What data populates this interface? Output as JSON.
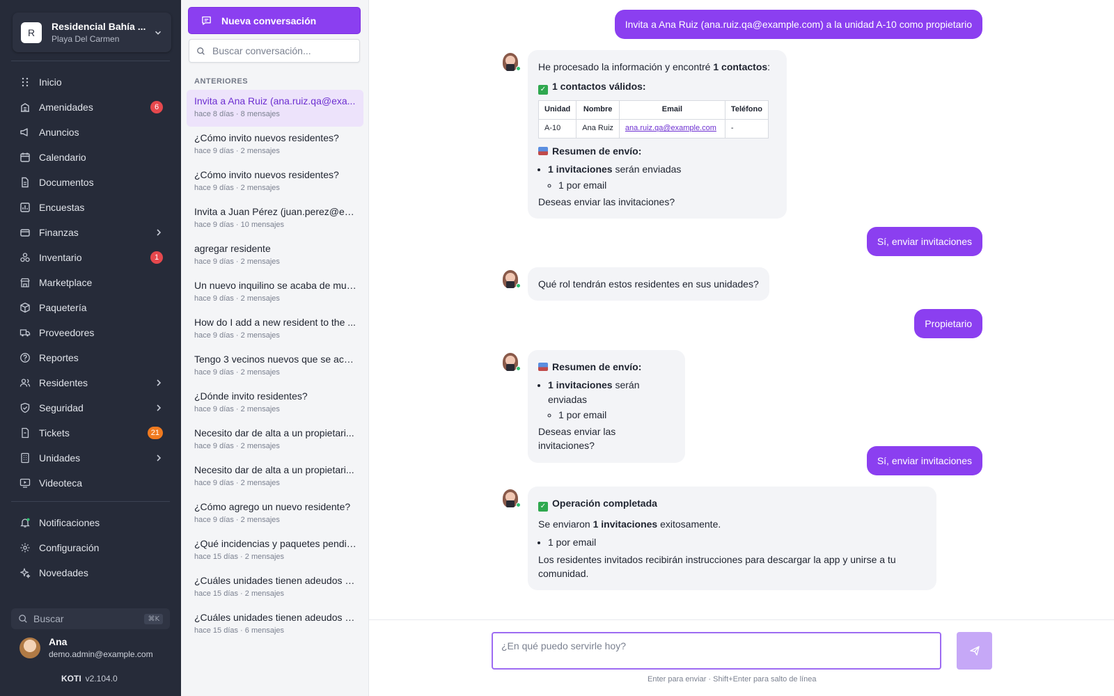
{
  "sidebar": {
    "org_initial": "R",
    "org_name": "Residencial Bahía ...",
    "org_city": "Playa Del Carmen",
    "items": [
      {
        "label": "Inicio",
        "icon": "grid-icon"
      },
      {
        "label": "Amenidades",
        "icon": "building-icon",
        "badge": "6"
      },
      {
        "label": "Anuncios",
        "icon": "megaphone-icon"
      },
      {
        "label": "Calendario",
        "icon": "calendar-icon"
      },
      {
        "label": "Documentos",
        "icon": "document-icon"
      },
      {
        "label": "Encuestas",
        "icon": "poll-icon"
      },
      {
        "label": "Finanzas",
        "icon": "wallet-icon",
        "expandable": true
      },
      {
        "label": "Inventario",
        "icon": "boxes-icon",
        "badge": "1"
      },
      {
        "label": "Marketplace",
        "icon": "store-icon"
      },
      {
        "label": "Paquetería",
        "icon": "package-icon"
      },
      {
        "label": "Proveedores",
        "icon": "truck-icon"
      },
      {
        "label": "Reportes",
        "icon": "help-circle-icon"
      },
      {
        "label": "Residentes",
        "icon": "users-icon",
        "expandable": true
      },
      {
        "label": "Seguridad",
        "icon": "shield-icon",
        "expandable": true
      },
      {
        "label": "Tickets",
        "icon": "ticket-icon",
        "badge": "21"
      },
      {
        "label": "Unidades",
        "icon": "apartment-icon",
        "expandable": true
      },
      {
        "label": "Videoteca",
        "icon": "video-icon"
      }
    ],
    "bottom_items": [
      {
        "label": "Notificaciones",
        "icon": "bell-icon"
      },
      {
        "label": "Configuración",
        "icon": "gear-icon"
      },
      {
        "label": "Novedades",
        "icon": "sparkle-icon"
      }
    ],
    "search_label": "Buscar",
    "search_shortcut": "⌘K",
    "user_name": "Ana",
    "user_email": "demo.admin@example.com",
    "brand": "KOTI",
    "version": "v2.104.0"
  },
  "conversations": {
    "new_label": "Nueva conversación",
    "search_placeholder": "Buscar conversación...",
    "section_label": "ANTERIORES",
    "items": [
      {
        "title": "Invita a Ana Ruiz (ana.ruiz.qa@exa...",
        "meta": "hace 8 días · 8 mensajes"
      },
      {
        "title": "¿Cómo invito nuevos residentes?",
        "meta": "hace 9 días · 2 mensajes"
      },
      {
        "title": "¿Cómo invito nuevos residentes?",
        "meta": "hace 9 días · 2 mensajes"
      },
      {
        "title": "Invita a Juan Pérez (juan.perez@ex...",
        "meta": "hace 9 días · 10 mensajes"
      },
      {
        "title": "agregar residente",
        "meta": "hace 9 días · 2 mensajes"
      },
      {
        "title": "Un nuevo inquilino se acaba de mud...",
        "meta": "hace 9 días · 2 mensajes"
      },
      {
        "title": "How do I add a new resident to the ...",
        "meta": "hace 9 días · 2 mensajes"
      },
      {
        "title": "Tengo 3 vecinos nuevos que se aca...",
        "meta": "hace 9 días · 2 mensajes"
      },
      {
        "title": "¿Dónde invito residentes?",
        "meta": "hace 9 días · 2 mensajes"
      },
      {
        "title": "Necesito dar de alta a un propietari...",
        "meta": "hace 9 días · 2 mensajes"
      },
      {
        "title": "Necesito dar de alta a un propietari...",
        "meta": "hace 9 días · 2 mensajes"
      },
      {
        "title": "¿Cómo agrego un nuevo residente?",
        "meta": "hace 9 días · 2 mensajes"
      },
      {
        "title": "¿Qué incidencias y paquetes pendie...",
        "meta": "hace 15 días · 2 mensajes"
      },
      {
        "title": "¿Cuáles unidades tienen adeudos v...",
        "meta": "hace 15 días · 2 mensajes"
      },
      {
        "title": "¿Cuáles unidades tienen adeudos v...",
        "meta": "hace 15 días · 6 mensajes"
      }
    ]
  },
  "chat": {
    "msg1_user": "Invita a Ana Ruiz (ana.ruiz.qa@example.com) a la unidad A-10 como propietario",
    "msg2": {
      "intro_pre": "He procesado la información y encontré ",
      "intro_bold": "1 contactos",
      "intro_post": ":",
      "valid_label": "1 contactos válidos:",
      "table_headers": [
        "Unidad",
        "Nombre",
        "Email",
        "Teléfono"
      ],
      "table_row": [
        "A-10",
        "Ana Ruiz",
        "ana.ruiz.qa@example.com",
        "-"
      ],
      "summary_label": "Resumen de envío:",
      "bullet_bold": "1 invitaciones",
      "bullet_rest": " serán enviadas",
      "sub_bullet": "1 por email",
      "question": "Deseas enviar las invitaciones?"
    },
    "msg3_user": "Sí, enviar invitaciones",
    "msg4_bot": "Qué rol tendrán estos residentes en sus unidades?",
    "msg5_user": "Propietario",
    "msg6": {
      "summary_label": "Resumen de envío:",
      "bullet_bold": "1 invitaciones",
      "bullet_rest": " serán enviadas",
      "sub_bullet": "1 por email",
      "question": "Deseas enviar las invitaciones?"
    },
    "msg7_user": "Sí, enviar invitaciones",
    "msg8": {
      "title": "Operación completada",
      "line_pre": "Se enviaron ",
      "line_bold": "1 invitaciones",
      "line_post": " exitosamente.",
      "bullet": "1 por email",
      "footer": "Los residentes invitados recibirán instrucciones para descargar la app y unirse a tu comunidad."
    },
    "composer_placeholder": "¿En qué puedo servirle hoy?",
    "hint": "Enter para enviar · Shift+Enter para salto de línea"
  },
  "colors": {
    "accent": "#8b3ff0",
    "sidebar_bg": "#262b39",
    "badge_red": "#e5484d",
    "badge_orange": "#f07a1f"
  }
}
